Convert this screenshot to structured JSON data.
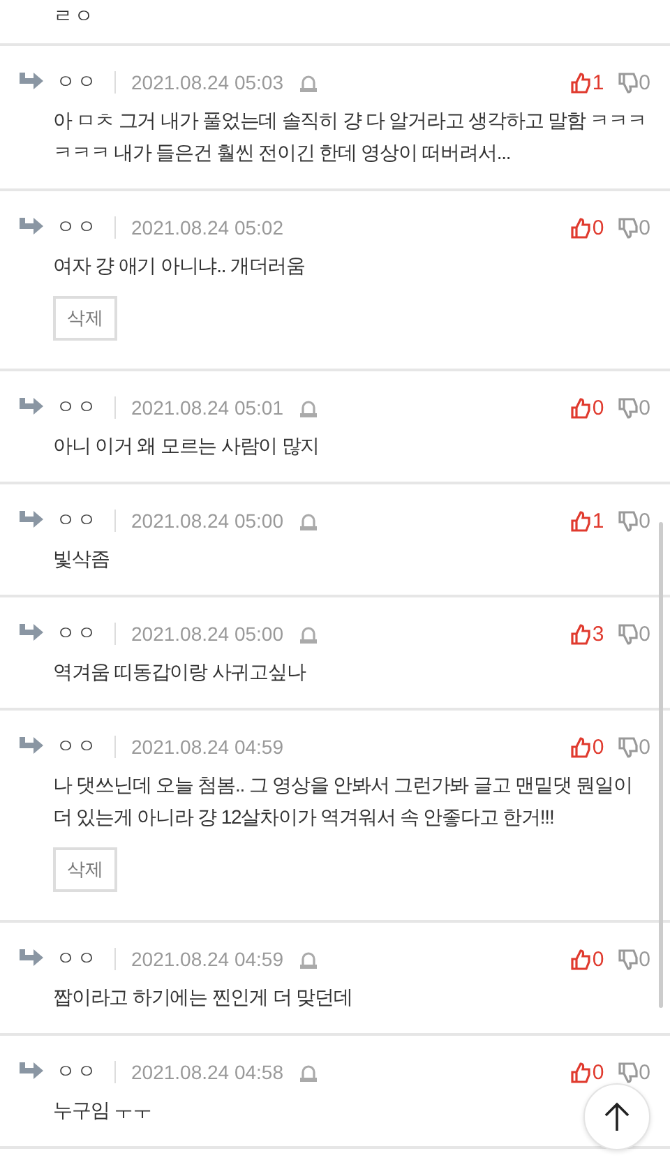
{
  "top_fragment": {
    "text": "ㄹㅇ"
  },
  "comments": [
    {
      "author": "ㅇㅇ",
      "date": "2021.08.24 05:03",
      "report_icon": true,
      "text": "아 ㅁㅊ 그거 내가 풀었는데 솔직히 걍 다 알거라고 생각하고 말함 ㅋㅋㅋㅋㅋㅋ 내가 들은건 훨씬 전이긴 한데 영상이 떠버려서...",
      "likes": "1",
      "dislikes": "0"
    },
    {
      "author": "ㅇㅇ",
      "date": "2021.08.24 05:02",
      "report_icon": false,
      "text": "여자 걍 애기 아니냐.. 개더러움",
      "delete_button": "삭제",
      "likes": "0",
      "dislikes": "0"
    },
    {
      "author": "ㅇㅇ",
      "date": "2021.08.24 05:01",
      "report_icon": true,
      "text": "아니 이거 왜 모르는 사람이 많지",
      "likes": "0",
      "dislikes": "0"
    },
    {
      "author": "ㅇㅇ",
      "date": "2021.08.24 05:00",
      "report_icon": true,
      "text": "빛삭좀",
      "likes": "1",
      "dislikes": "0"
    },
    {
      "author": "ㅇㅇ",
      "date": "2021.08.24 05:00",
      "report_icon": true,
      "text": "역겨움 띠동갑이랑 사귀고싶나",
      "likes": "3",
      "dislikes": "0"
    },
    {
      "author": "ㅇㅇ",
      "date": "2021.08.24 04:59",
      "report_icon": false,
      "text": "나 댓쓰닌데 오늘 첨봄.. 그 영상을 안봐서 그런가봐 글고 맨밑댓 뭔일이 더 있는게 아니라 걍 12살차이가 역겨워서 속 안좋다고 한거!!!",
      "delete_button": "삭제",
      "likes": "0",
      "dislikes": "0"
    },
    {
      "author": "ㅇㅇ",
      "date": "2021.08.24 04:59",
      "report_icon": true,
      "text": "짭이라고 하기에는 찐인게 더 맞던데",
      "likes": "0",
      "dislikes": "0"
    },
    {
      "author": "ㅇㅇ",
      "date": "2021.08.24 04:58",
      "report_icon": true,
      "text": "누구임 ㅜㅜ",
      "likes": "0",
      "dislikes": "0"
    }
  ]
}
